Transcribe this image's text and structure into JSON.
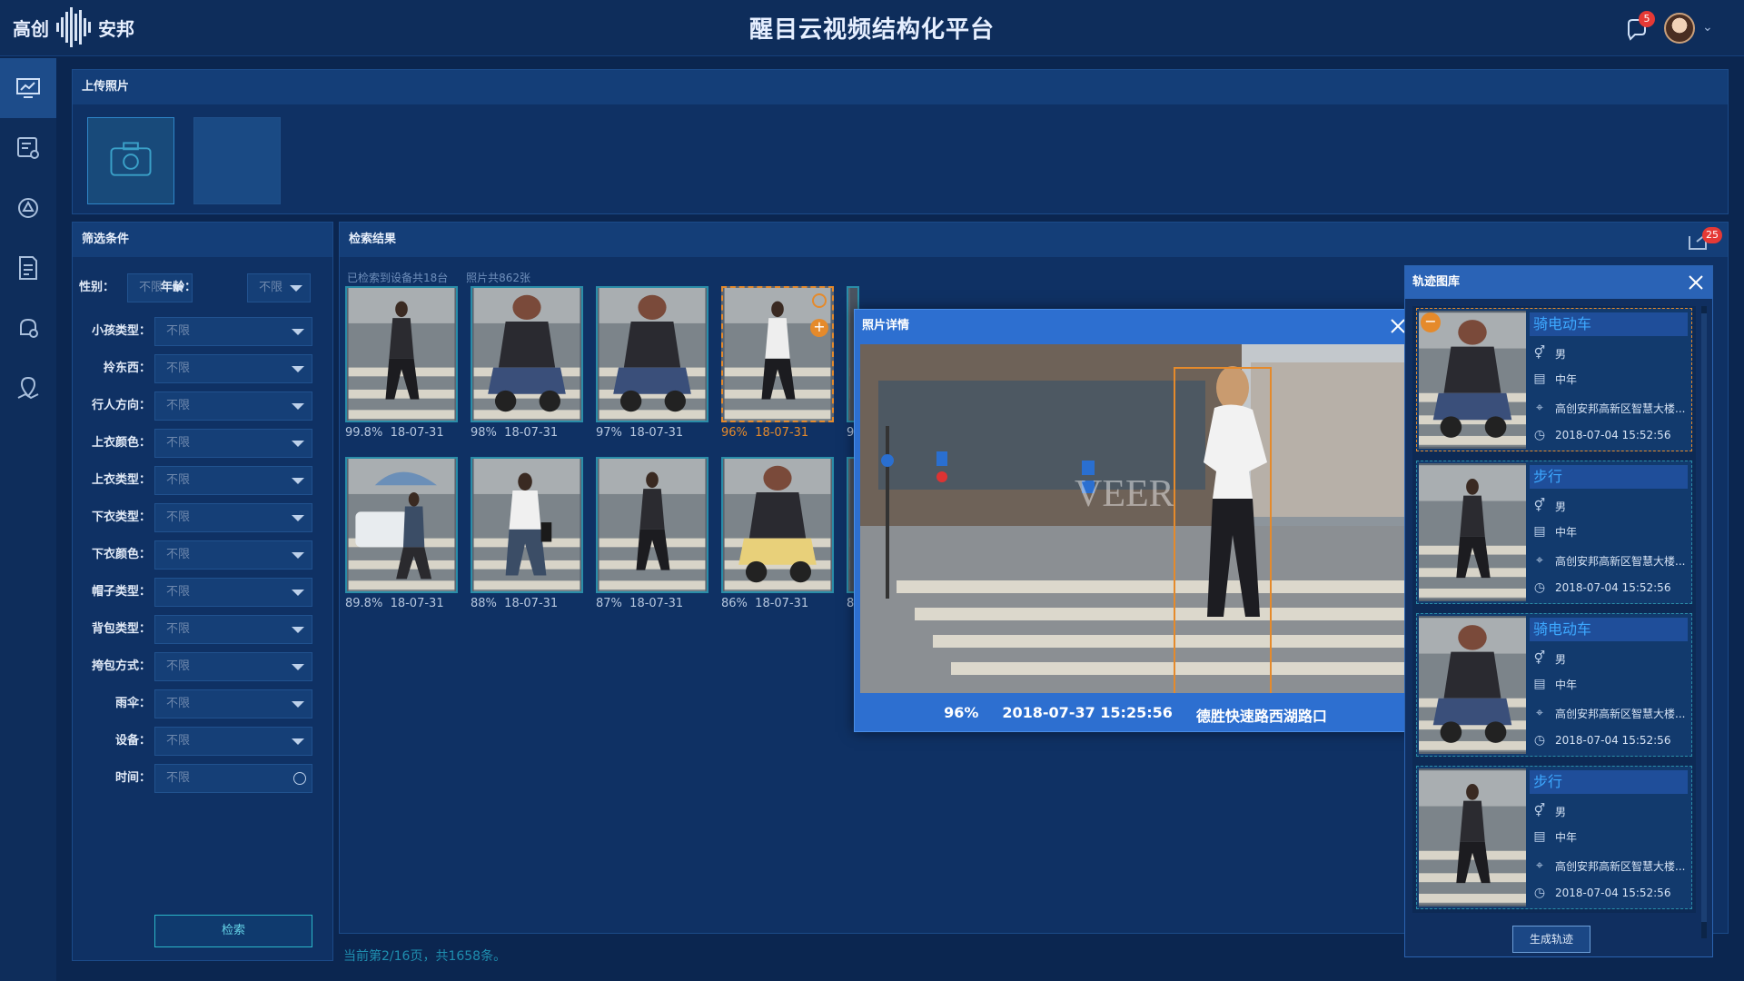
{
  "header": {
    "logo_left": "高创",
    "logo_right": "安邦",
    "title": "醒目云视频结构化平台",
    "notification_count": "5"
  },
  "sidenav": {
    "items": [
      "monitor-icon",
      "list-settings-icon",
      "shield-icon",
      "report-icon",
      "alarm-icon",
      "map-pin-icon"
    ]
  },
  "upload": {
    "title": "上传照片"
  },
  "filters": {
    "title": "筛选条件",
    "gender_label": "性别：",
    "gender_value": "不限",
    "age_label": "年龄：",
    "age_value": "不限",
    "rows": [
      {
        "label": "小孩类型：",
        "value": "不限"
      },
      {
        "label": "拎东西：",
        "value": "不限"
      },
      {
        "label": "行人方向：",
        "value": "不限"
      },
      {
        "label": "上衣颜色：",
        "value": "不限"
      },
      {
        "label": "上衣类型：",
        "value": "不限"
      },
      {
        "label": "下衣类型：",
        "value": "不限"
      },
      {
        "label": "下衣颜色：",
        "value": "不限"
      },
      {
        "label": "帽子类型：",
        "value": "不限"
      },
      {
        "label": "背包类型：",
        "value": "不限"
      },
      {
        "label": "挎包方式：",
        "value": "不限"
      },
      {
        "label": "雨伞：",
        "value": "不限"
      },
      {
        "label": "设备：",
        "value": "不限"
      },
      {
        "label": "时间：",
        "value": "不限"
      }
    ],
    "search_button": "检索"
  },
  "results": {
    "title": "检索结果",
    "device_count_text": "已检索到设备共18台",
    "photo_count_text": "照片共862张",
    "fullscreen_badge": "25",
    "items": [
      {
        "score": "99.8%",
        "date": "18-07-31",
        "subject": "woman"
      },
      {
        "score": "98%",
        "date": "18-07-31",
        "subject": "scooter"
      },
      {
        "score": "97%",
        "date": "18-07-31",
        "subject": "scooter"
      },
      {
        "score": "96%",
        "date": "18-07-31",
        "subject": "woman-white",
        "selected": true
      },
      {
        "score": "9",
        "date": "",
        "subject": "partial"
      },
      {
        "score": "89.8%",
        "date": "18-07-31",
        "subject": "umbrella"
      },
      {
        "score": "88%",
        "date": "18-07-31",
        "subject": "man"
      },
      {
        "score": "87%",
        "date": "18-07-31",
        "subject": "woman"
      },
      {
        "score": "86%",
        "date": "18-07-31",
        "subject": "scooter-yellow"
      },
      {
        "score": "8",
        "date": "",
        "subject": "partial"
      }
    ],
    "pagination": "当前第2/16页，共1658条。"
  },
  "detail_modal": {
    "title": "照片详情",
    "score": "96%",
    "datetime": "2018-07-37 15:25:56",
    "location": "德胜快速路西湖路口",
    "watermark": "VEER"
  },
  "track_library": {
    "title": "轨迹图库",
    "cards": [
      {
        "type": "骑电动车",
        "gender": "男",
        "age": "中年",
        "location": "高创安邦高新区智慧大楼...",
        "time": "2018-07-04  15:52:56",
        "selected": true,
        "subject": "scooter"
      },
      {
        "type": "步行",
        "gender": "男",
        "age": "中年",
        "location": "高创安邦高新区智慧大楼...",
        "time": "2018-07-04  15:52:56",
        "selected": false,
        "subject": "woman"
      },
      {
        "type": "骑电动车",
        "gender": "男",
        "age": "中年",
        "location": "高创安邦高新区智慧大楼...",
        "time": "2018-07-04  15:52:56",
        "selected": false,
        "subject": "scooter"
      },
      {
        "type": "步行",
        "gender": "男",
        "age": "中年",
        "location": "高创安邦高新区智慧大楼...",
        "time": "2018-07-04  15:52:56",
        "selected": false,
        "subject": "woman"
      }
    ],
    "generate_button": "生成轨迹"
  },
  "colors": {
    "accent_orange": "#e58a2b",
    "accent_cyan": "#2a8da8",
    "track_title_blue": "#3da8ff"
  }
}
